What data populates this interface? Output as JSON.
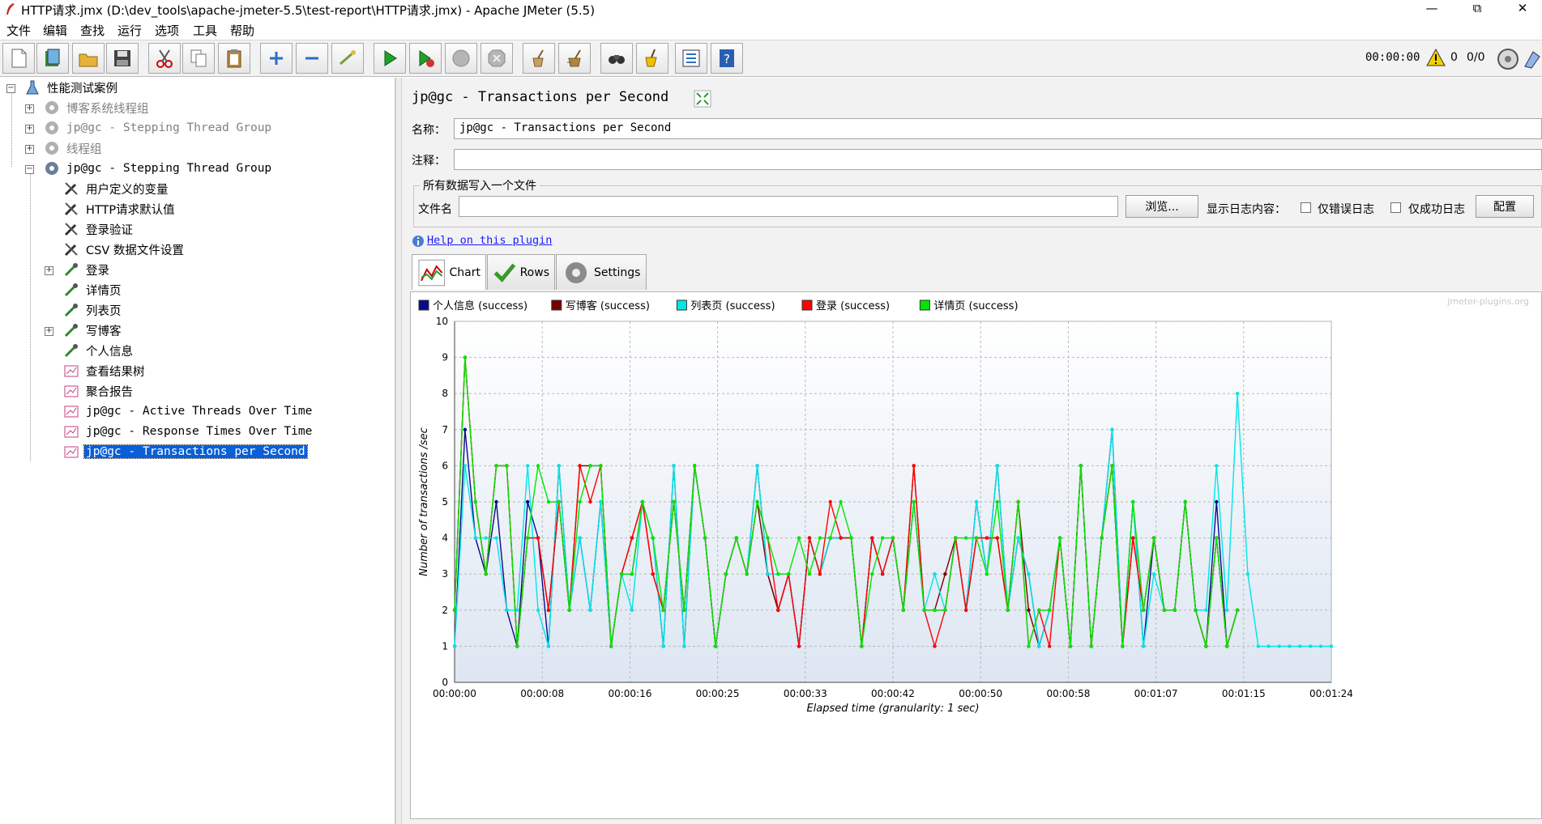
{
  "window": {
    "title": "HTTP请求.jmx (D:\\dev_tools\\apache-jmeter-5.5\\test-report\\HTTP请求.jmx) - Apache JMeter (5.5)",
    "minimize": "—",
    "maximize": "⧉",
    "close": "✕"
  },
  "menu": [
    "文件",
    "编辑",
    "查找",
    "运行",
    "选项",
    "工具",
    "帮助"
  ],
  "toolbar": {
    "elapsed": "00:00:00",
    "warnings": "0",
    "threads": "0/0"
  },
  "tree": [
    {
      "label": "性能测试案例",
      "state": "normal"
    },
    {
      "label": "博客系统线程组",
      "state": "disabled"
    },
    {
      "label": "jp@gc - Stepping Thread Group",
      "state": "disabled"
    },
    {
      "label": "线程组",
      "state": "disabled"
    },
    {
      "label": "jp@gc - Stepping Thread Group",
      "state": "normal"
    },
    {
      "label": "用户定义的变量",
      "state": "normal"
    },
    {
      "label": "HTTP请求默认值",
      "state": "normal"
    },
    {
      "label": "登录验证",
      "state": "normal"
    },
    {
      "label": "CSV 数据文件设置",
      "state": "normal"
    },
    {
      "label": "登录",
      "state": "normal"
    },
    {
      "label": "详情页",
      "state": "normal"
    },
    {
      "label": "列表页",
      "state": "normal"
    },
    {
      "label": "写博客",
      "state": "normal"
    },
    {
      "label": "个人信息",
      "state": "normal"
    },
    {
      "label": "查看结果树",
      "state": "normal"
    },
    {
      "label": "聚合报告",
      "state": "normal"
    },
    {
      "label": "jp@gc - Active Threads Over Time",
      "state": "normal"
    },
    {
      "label": "jp@gc - Response Times Over Time",
      "state": "normal"
    },
    {
      "label": "jp@gc - Transactions per Second",
      "state": "selected"
    }
  ],
  "panel": {
    "title": "jp@gc - Transactions per Second",
    "name_label": "名称：",
    "name_value": "jp@gc - Transactions per Second",
    "comment_label": "注释：",
    "comment_value": "",
    "group_title": "所有数据写入一个文件",
    "file_label": "文件名",
    "file_value": "",
    "browse": "浏览...",
    "log_label": "显示日志内容：",
    "errors_only": "仅错误日志",
    "success_only": "仅成功日志",
    "configure": "配置",
    "help": "Help on this plugin",
    "tabs": [
      "Chart",
      "Rows",
      "Settings"
    ]
  },
  "chart_data": {
    "type": "line",
    "watermark": "jmeter-plugins.org",
    "xlabel": "Elapsed time (granularity: 1 sec)",
    "ylabel": "Number of transactions /sec",
    "ylim": [
      0,
      10
    ],
    "xlim": [
      0,
      84
    ],
    "yticks": [
      "0",
      "1",
      "2",
      "3",
      "4",
      "5",
      "6",
      "7",
      "8",
      "9",
      "10"
    ],
    "xticks": [
      "00:00:00",
      "00:00:08",
      "00:00:16",
      "00:00:25",
      "00:00:33",
      "00:00:42",
      "00:00:50",
      "00:00:58",
      "00:01:07",
      "00:01:15",
      "00:01:24"
    ],
    "grid": true,
    "legend": "top",
    "series": [
      {
        "name": "个人信息 (success)",
        "color": "#0a0a8c",
        "x": [
          0,
          1,
          2,
          3,
          4,
          5,
          6,
          7,
          8,
          9,
          10,
          11,
          12,
          13,
          14,
          15,
          16,
          17,
          18,
          19,
          20,
          21,
          22,
          23,
          24,
          25,
          26,
          27,
          28,
          29,
          30,
          31,
          32,
          33,
          34,
          35,
          36,
          37,
          38,
          39,
          40,
          41,
          42,
          43,
          44,
          45,
          46,
          47,
          48,
          49,
          50,
          51,
          52,
          53,
          54,
          55,
          56,
          57,
          58,
          59,
          60,
          61,
          62,
          63,
          64,
          65,
          66,
          67,
          68,
          69,
          70,
          71,
          72,
          73,
          74,
          75
        ],
        "values": [
          1,
          7,
          4,
          3,
          5,
          2,
          1,
          5,
          4,
          1,
          6,
          2,
          4,
          2,
          5,
          1,
          3,
          3,
          5,
          4,
          1,
          6,
          1,
          6,
          4,
          1,
          3,
          4,
          3,
          6,
          3,
          2,
          3,
          1,
          4,
          3,
          4,
          4,
          4,
          1,
          4,
          3,
          4,
          2,
          5,
          2,
          2,
          2,
          4,
          2,
          5,
          3,
          6,
          2,
          4,
          3,
          1,
          2,
          4,
          1,
          6,
          1,
          4,
          7,
          1,
          5,
          1,
          4,
          2,
          2,
          5,
          2,
          1,
          5,
          1,
          2
        ]
      },
      {
        "name": "写博客 (success)",
        "color": "#7a0000",
        "x": [
          0,
          1,
          2,
          3,
          4,
          5,
          6,
          7,
          8,
          9,
          10,
          11,
          12,
          13,
          14,
          15,
          16,
          17,
          18,
          19,
          20,
          21,
          22,
          23,
          24,
          25,
          26,
          27,
          28,
          29,
          30,
          31,
          32,
          33,
          34,
          35,
          36,
          37,
          38,
          39,
          40,
          41,
          42,
          43,
          44,
          45,
          46,
          47,
          48,
          49,
          50,
          51,
          52,
          53,
          54,
          55,
          56,
          57,
          58,
          59,
          60,
          61,
          62,
          63,
          64,
          65,
          66,
          67,
          68,
          69,
          70,
          71,
          72,
          73,
          74,
          75
        ],
        "values": [
          2,
          9,
          5,
          3,
          6,
          6,
          1,
          4,
          4,
          2,
          5,
          2,
          6,
          6,
          6,
          1,
          3,
          4,
          5,
          3,
          2,
          5,
          2,
          6,
          4,
          1,
          3,
          4,
          3,
          5,
          3,
          2,
          3,
          1,
          4,
          3,
          4,
          4,
          4,
          1,
          4,
          3,
          4,
          2,
          6,
          2,
          2,
          3,
          4,
          2,
          4,
          4,
          4,
          2,
          5,
          2,
          1,
          2,
          4,
          1,
          6,
          1,
          4,
          6,
          1,
          4,
          2,
          4,
          2,
          2,
          5,
          2,
          1,
          4,
          1,
          2
        ]
      },
      {
        "name": "列表页 (success)",
        "color": "#00e6e6",
        "x": [
          0,
          1,
          2,
          3,
          4,
          5,
          6,
          7,
          8,
          9,
          10,
          11,
          12,
          13,
          14,
          15,
          16,
          17,
          18,
          19,
          20,
          21,
          22,
          23,
          24,
          25,
          26,
          27,
          28,
          29,
          30,
          31,
          32,
          33,
          34,
          35,
          36,
          37,
          38,
          39,
          40,
          41,
          42,
          43,
          44,
          45,
          46,
          47,
          48,
          49,
          50,
          51,
          52,
          53,
          54,
          55,
          56,
          57,
          58,
          59,
          60,
          61,
          62,
          63,
          64,
          65,
          66,
          67,
          68,
          69,
          70,
          71,
          72,
          73,
          74,
          75,
          76,
          77,
          78,
          79,
          80,
          81,
          82,
          83,
          84
        ],
        "values": [
          1,
          6,
          4,
          4,
          4,
          2,
          2,
          6,
          2,
          1,
          6,
          2,
          4,
          2,
          5,
          1,
          3,
          2,
          5,
          4,
          1,
          6,
          1,
          6,
          4,
          1,
          3,
          4,
          3,
          6,
          3,
          3,
          3,
          1,
          4,
          3,
          4,
          4,
          4,
          1,
          4,
          3,
          4,
          2,
          5,
          2,
          3,
          2,
          4,
          2,
          5,
          3,
          6,
          2,
          4,
          3,
          1,
          2,
          4,
          1,
          6,
          1,
          4,
          7,
          1,
          5,
          1,
          3,
          2,
          2,
          5,
          2,
          2,
          6,
          2,
          8,
          3,
          1,
          1,
          1,
          1,
          1,
          1,
          1,
          1
        ]
      },
      {
        "name": "登录 (success)",
        "color": "#ff0000",
        "x": [
          0,
          1,
          2,
          3,
          4,
          5,
          6,
          7,
          8,
          9,
          10,
          11,
          12,
          13,
          14,
          15,
          16,
          17,
          18,
          19,
          20,
          21,
          22,
          23,
          24,
          25,
          26,
          27,
          28,
          29,
          30,
          31,
          32,
          33,
          34,
          35,
          36,
          37,
          38,
          39,
          40,
          41,
          42,
          43,
          44,
          45,
          46,
          47,
          48,
          49,
          50,
          51,
          52,
          53,
          54,
          55,
          56,
          57,
          58,
          59,
          60,
          61,
          62,
          63,
          64,
          65,
          66,
          67,
          68,
          69,
          70,
          71,
          72,
          73,
          74,
          75
        ],
        "values": [
          2,
          9,
          5,
          3,
          6,
          6,
          1,
          4,
          4,
          2,
          5,
          2,
          6,
          5,
          6,
          1,
          3,
          4,
          5,
          3,
          2,
          5,
          2,
          6,
          4,
          1,
          3,
          4,
          3,
          5,
          4,
          2,
          3,
          1,
          4,
          3,
          5,
          4,
          4,
          1,
          4,
          3,
          4,
          2,
          6,
          2,
          1,
          2,
          4,
          2,
          4,
          4,
          4,
          2,
          5,
          1,
          2,
          1,
          4,
          1,
          6,
          1,
          4,
          6,
          1,
          4,
          2,
          4,
          2,
          2,
          5,
          2,
          1,
          4,
          1,
          2
        ]
      },
      {
        "name": "详情页 (success)",
        "color": "#00e600",
        "x": [
          0,
          1,
          2,
          3,
          4,
          5,
          6,
          7,
          8,
          9,
          10,
          11,
          12,
          13,
          14,
          15,
          16,
          17,
          18,
          19,
          20,
          21,
          22,
          23,
          24,
          25,
          26,
          27,
          28,
          29,
          30,
          31,
          32,
          33,
          34,
          35,
          36,
          37,
          38,
          39,
          40,
          41,
          42,
          43,
          44,
          45,
          46,
          47,
          48,
          49,
          50,
          51,
          52,
          53,
          54,
          55,
          56,
          57,
          58,
          59,
          60,
          61,
          62,
          63,
          64,
          65,
          66,
          67,
          68,
          69,
          70,
          71,
          72,
          73,
          74,
          75
        ],
        "values": [
          2,
          9,
          5,
          3,
          6,
          6,
          1,
          4,
          6,
          5,
          5,
          2,
          5,
          6,
          6,
          1,
          3,
          3,
          5,
          4,
          2,
          5,
          2,
          6,
          4,
          1,
          3,
          4,
          3,
          5,
          4,
          3,
          3,
          4,
          3,
          4,
          4,
          5,
          4,
          1,
          3,
          4,
          4,
          2,
          5,
          2,
          2,
          2,
          4,
          4,
          4,
          3,
          5,
          2,
          5,
          1,
          2,
          2,
          4,
          1,
          6,
          1,
          4,
          6,
          1,
          5,
          2,
          4,
          2,
          2,
          5,
          2,
          1,
          4,
          1,
          2
        ]
      }
    ]
  }
}
